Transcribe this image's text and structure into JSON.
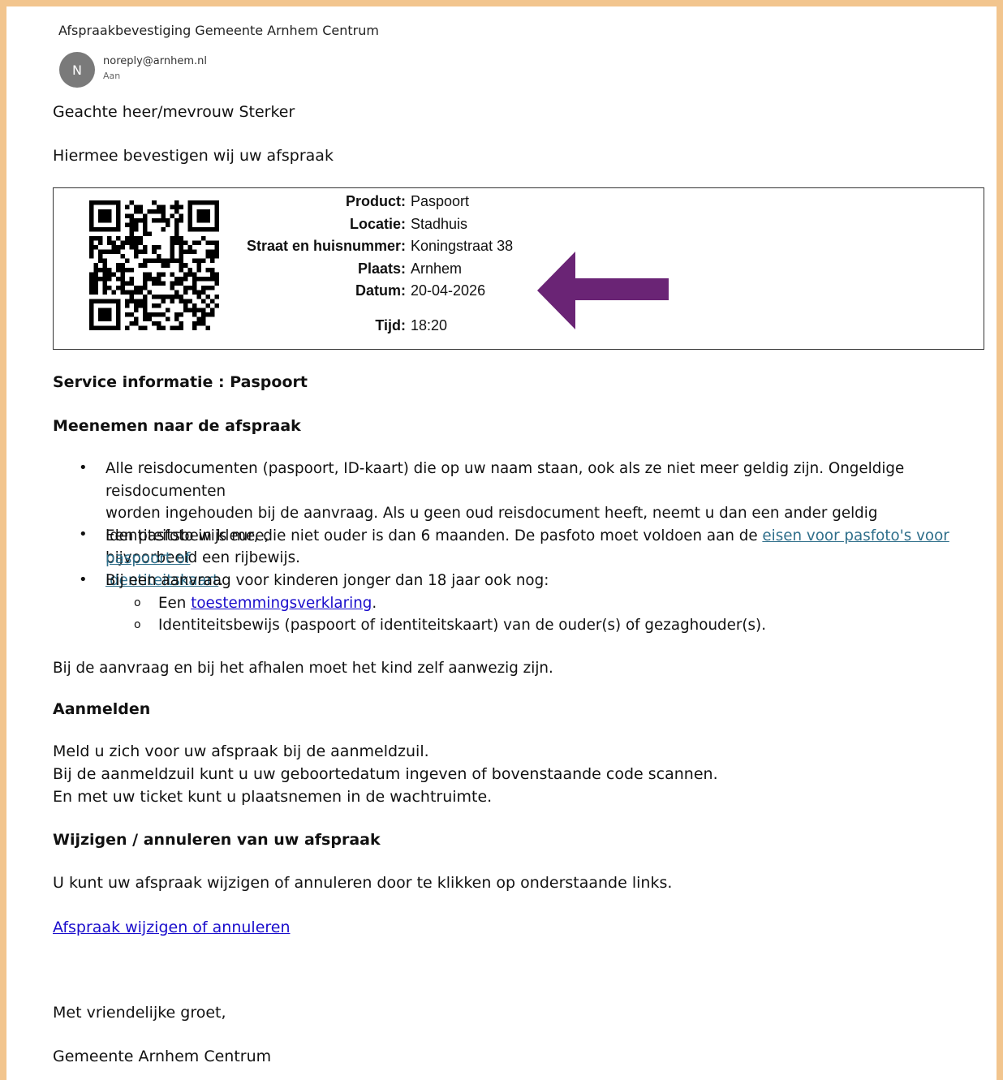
{
  "email": {
    "subject": "Afspraakbevestiging Gemeente Arnhem Centrum",
    "avatar_letter": "N",
    "from": "noreply@arnhem.nl",
    "to_label": "Aan"
  },
  "body": {
    "greeting": "Geachte heer/mevrouw Sterker",
    "confirm": "Hiermee bevestigen wij uw afspraak",
    "appointment": {
      "product_label": "Product:",
      "product": "Paspoort",
      "location_label": "Locatie:",
      "location": "Stadhuis",
      "street_label": "Straat en huisnummer:",
      "street": "Koningstraat 38",
      "city_label": "Plaats:",
      "city": "Arnhem",
      "date_label": "Datum:",
      "date": "20-04-2026",
      "time_label": "Tijd:",
      "time": "18:20"
    },
    "service_heading": "Service informatie : Paspoort",
    "bring_heading": "Meenemen naar de afspraak",
    "bullets": {
      "b1_l1": "Alle reisdocumenten (paspoort, ID-kaart) die op uw naam staan, ook als ze niet meer geldig zijn. Ongeldige reisdocumenten",
      "b1_l2": "worden ingehouden bij de aanvraag. Als u geen oud reisdocument heeft, neemt u dan een ander geldig identiteitsbewijs mee,",
      "b1_l3": "bijvoorbeeld een rijbewijs.",
      "b2_text": "Een pasfoto in kleur, die niet ouder is dan 6 maanden. De pasfoto moet voldoen aan de ",
      "b2_link_l1": "eisen voor pasfoto's voor paspoort of",
      "b2_link_l2": "identiteitskaart",
      "b2_end": ".",
      "b3": "Bij een aanvraag voor kinderen jonger dan 18 jaar ook nog:",
      "s1_text": "Een ",
      "s1_link": "toestemmingsverklaring",
      "s1_end": ".",
      "s2": "Identiteitsbewijs (paspoort of identiteitskaart) van de ouder(s) of gezaghouder(s)."
    },
    "child_note": "Bij de aanvraag en bij het afhalen moet het kind zelf aanwezig zijn.",
    "register_heading": "Aanmelden",
    "register_l1": "Meld u zich voor uw afspraak bij de aanmeldzuil.",
    "register_l2": "Bij de aanmeldzuil kunt u uw geboortedatum ingeven of bovenstaande code scannen.",
    "register_l3": "En met uw ticket kunt u plaatsnemen in de wachtruimte.",
    "change_heading": "Wijzigen / annuleren van uw afspraak",
    "change_text": "U kunt uw afspraak wijzigen of annuleren door te klikken op onderstaande links.",
    "change_link": "Afspraak wijzigen of annuleren",
    "closing": "Met vriendelijke groet,",
    "signature": "Gemeente Arnhem Centrum"
  },
  "colors": {
    "frame": "#f2c58e",
    "arrow": "#6a2475",
    "link": "#1a0dcc",
    "link_alt": "#2e6e8a"
  },
  "icons": {
    "qr": "qr-code",
    "arrow": "left-arrow-annotation"
  }
}
